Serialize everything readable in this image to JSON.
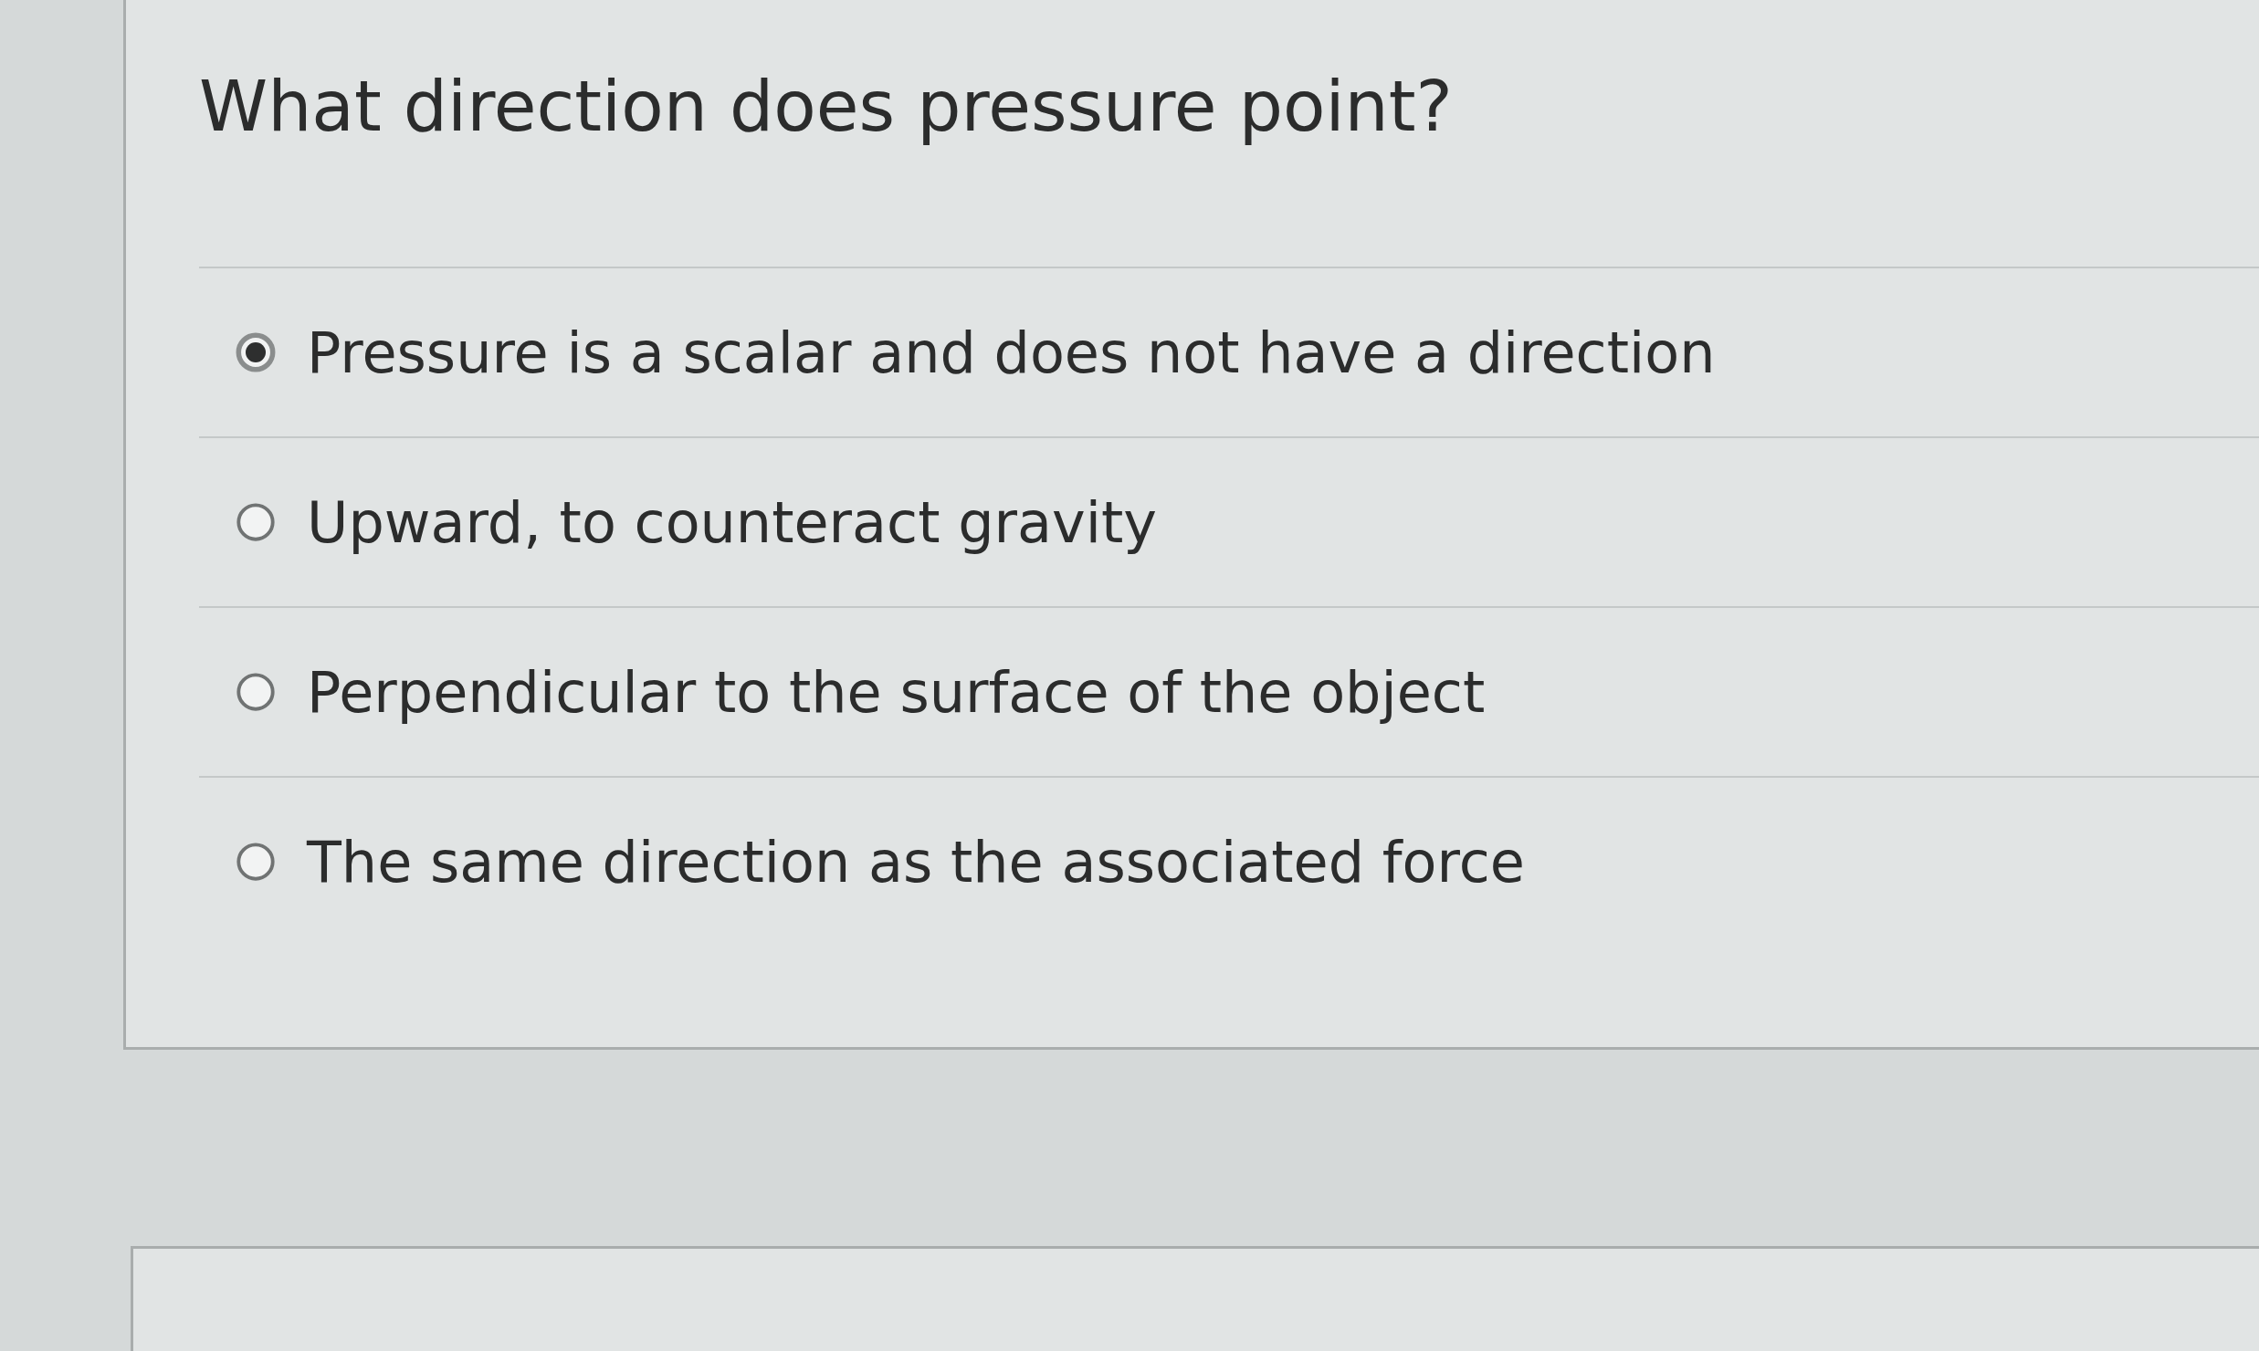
{
  "question": {
    "title": "What direction does pressure point?",
    "options": [
      {
        "label": "Pressure is a scalar and does not have a direction",
        "selected": true
      },
      {
        "label": "Upward, to counteract gravity",
        "selected": false
      },
      {
        "label": "Perpendicular to the surface of the object",
        "selected": false
      },
      {
        "label": "The same direction as the associated force",
        "selected": false
      }
    ]
  }
}
